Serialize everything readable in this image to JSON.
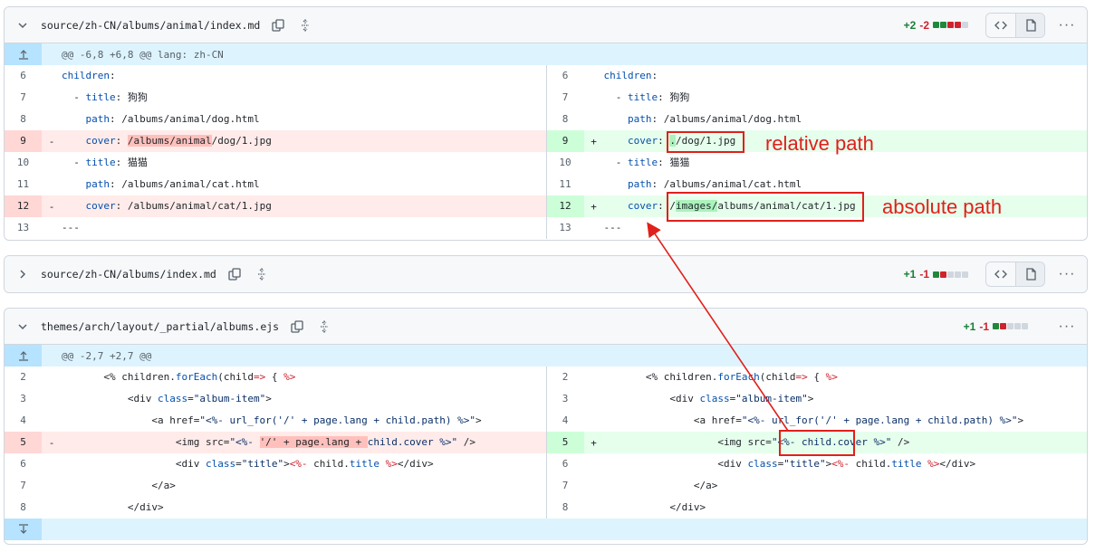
{
  "files": [
    {
      "path": "source/zh-CN/albums/animal/index.md",
      "additions": "+2",
      "deletions": "-2",
      "blocks": [
        "a",
        "a",
        "d",
        "d",
        "n"
      ],
      "hunk": "@@ -6,8 +6,8 @@ lang: zh-CN"
    },
    {
      "path": "source/zh-CN/albums/index.md",
      "additions": "+1",
      "deletions": "-1",
      "blocks": [
        "a",
        "d",
        "n",
        "n",
        "n"
      ]
    },
    {
      "path": "themes/arch/layout/_partial/albums.ejs",
      "additions": "+1",
      "deletions": "-1",
      "blocks": [
        "a",
        "d",
        "n",
        "n",
        "n"
      ],
      "hunk": "@@ -2,7 +2,7 @@"
    }
  ],
  "file1_left": [
    {
      "ln": "6",
      "code": "  children:"
    },
    {
      "ln": "7",
      "code": "    - title: 狗狗"
    },
    {
      "ln": "8",
      "code": "      path: /albums/animal/dog.html"
    },
    {
      "ln": "9",
      "marker": "-",
      "code_pre": "      cover: ",
      "code_hl": "/albums/animal",
      "code_post": "/dog/1.jpg"
    },
    {
      "ln": "10",
      "code": "    - title: 猫猫"
    },
    {
      "ln": "11",
      "code": "      path: /albums/animal/cat.html"
    },
    {
      "ln": "12",
      "marker": "-",
      "code": "      cover: /albums/animal/cat/1.jpg"
    },
    {
      "ln": "13",
      "code": "  ---"
    }
  ],
  "file1_right": [
    {
      "ln": "6",
      "code": "  children:"
    },
    {
      "ln": "7",
      "code": "    - title: 狗狗"
    },
    {
      "ln": "8",
      "code": "      path: /albums/animal/dog.html"
    },
    {
      "ln": "9",
      "marker": "+",
      "code_pre": "      cover: ",
      "code_hl": ".",
      "code_post": "/dog/1.jpg"
    },
    {
      "ln": "10",
      "code": "    - title: 猫猫"
    },
    {
      "ln": "11",
      "code": "      path: /albums/animal/cat.html"
    },
    {
      "ln": "12",
      "marker": "+",
      "code_pre": "      cover: /",
      "code_hl": "images/",
      "code_post": "albums/animal/cat/1.jpg"
    },
    {
      "ln": "13",
      "code": "  ---"
    }
  ],
  "file3_left": [
    {
      "ln": "2",
      "code": "        <% children.forEach(child=> { %>"
    },
    {
      "ln": "3",
      "code": "            <div class=\"album-item\">"
    },
    {
      "ln": "4",
      "code": "                <a href=\"<%- url_for('/' + page.lang + child.path) %>\">"
    },
    {
      "ln": "5",
      "marker": "-",
      "code_pre": "                    <img src=\"<%- ",
      "code_hl": "'/' + page.lang + ",
      "code_post": "child.cover %>\" />"
    },
    {
      "ln": "6",
      "code": "                    <div class=\"title\"><%- child.title %></div>"
    },
    {
      "ln": "7",
      "code": "                </a>"
    },
    {
      "ln": "8",
      "code": "            </div>"
    }
  ],
  "file3_right": [
    {
      "ln": "2",
      "code": "        <% children.forEach(child=> { %>"
    },
    {
      "ln": "3",
      "code": "            <div class=\"album-item\">"
    },
    {
      "ln": "4",
      "code": "                <a href=\"<%- url_for('/' + page.lang + child.path) %>\">"
    },
    {
      "ln": "5",
      "marker": "+",
      "code": "                    <img src=\"<%- child.cover %>\" />"
    },
    {
      "ln": "6",
      "code": "                    <div class=\"title\"><%- child.title %></div>"
    },
    {
      "ln": "7",
      "code": "                </a>"
    },
    {
      "ln": "8",
      "code": "            </div>"
    }
  ],
  "annotations": {
    "relative": "relative path",
    "absolute": "absolute path",
    "color": "#e0201a"
  }
}
